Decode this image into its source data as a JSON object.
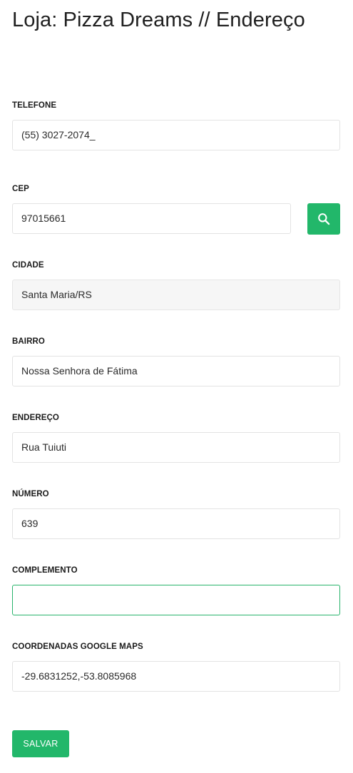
{
  "header": {
    "title": "Loja: Pizza Dreams // Endereço"
  },
  "form": {
    "telefone": {
      "label": "TELEFONE",
      "value": "(55) 3027-2074_"
    },
    "cep": {
      "label": "CEP",
      "value": "97015661",
      "search_icon": "search-icon"
    },
    "cidade": {
      "label": "CIDADE",
      "value": "Santa Maria/RS"
    },
    "bairro": {
      "label": "BAIRRO",
      "value": "Nossa Senhora de Fátima"
    },
    "endereco": {
      "label": "ENDEREÇO",
      "value": "Rua Tuiuti"
    },
    "numero": {
      "label": "NÚMERO",
      "value": "639"
    },
    "complemento": {
      "label": "COMPLEMENTO",
      "value": ""
    },
    "coordenadas": {
      "label": "COORDENADAS GOOGLE MAPS",
      "value": "-29.6831252,-53.8085968"
    }
  },
  "actions": {
    "save_label": "SALVAR"
  },
  "colors": {
    "accent": "#22b76a",
    "readonly_bg": "#f6f6f6",
    "focus_border": "#27b36b"
  }
}
